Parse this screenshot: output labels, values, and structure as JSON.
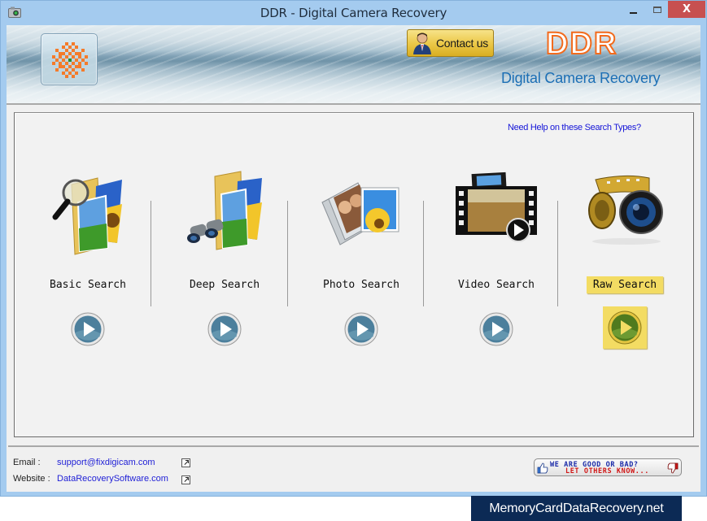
{
  "window": {
    "title": "DDR - Digital Camera Recovery",
    "app_icon": "camera-icon",
    "controls": {
      "minimize": "minimize-icon",
      "maximize": "maximize-icon",
      "close_label": "X"
    }
  },
  "header": {
    "logo_icon": "ddr-pixel-logo-icon",
    "contact_button": "Contact us",
    "brand": "DDR",
    "product": "Digital Camera Recovery",
    "colors": {
      "brand_orange": "#f26b1d",
      "product_blue": "#1c6fb5",
      "contact_gold": "#ecc94a"
    }
  },
  "main": {
    "help_link": "Need Help on these Search Types?",
    "search_types": [
      {
        "label": "Basic Search",
        "icon": "folder-magnifier-icon",
        "selected": false
      },
      {
        "label": "Deep Search",
        "icon": "folder-binoculars-icon",
        "selected": false
      },
      {
        "label": "Photo Search",
        "icon": "photo-stack-icon",
        "selected": false
      },
      {
        "label": "Video Search",
        "icon": "video-film-icon",
        "selected": false
      },
      {
        "label": "Raw Search",
        "icon": "film-camera-lens-icon",
        "selected": true
      }
    ],
    "highlight_color": "#f3dc63"
  },
  "footer": {
    "email_label": "Email :",
    "email_value": "support@fixdigicam.com",
    "website_label": "Website :",
    "website_value": "DataRecoverySoftware.com",
    "rating_line1": "WE ARE GOOD OR BAD?",
    "rating_line2": "LET OTHERS KNOW..."
  },
  "watermark": "MemoryCardDataRecovery.net"
}
